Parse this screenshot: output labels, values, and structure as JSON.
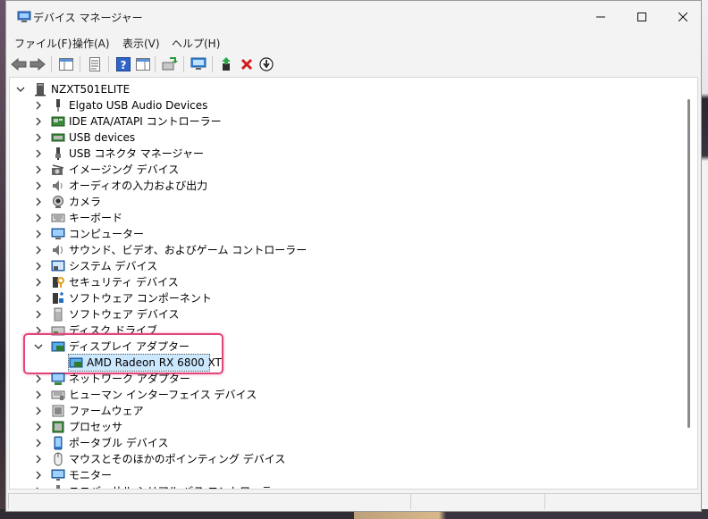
{
  "window": {
    "title": "デバイス マネージャー"
  },
  "menu": [
    "ファイル(F)",
    "操作(A)",
    "表示(V)",
    "ヘルプ(H)"
  ],
  "tree": {
    "root": "NZXT501ELITE",
    "categories": [
      {
        "label": "Elgato USB Audio Devices",
        "icon": "audio-jack-icon"
      },
      {
        "label": "IDE ATA/ATAPI コントローラー",
        "icon": "storage-controller-icon"
      },
      {
        "label": "USB devices",
        "icon": "usb-device-icon"
      },
      {
        "label": "USB コネクタ マネージャー",
        "icon": "usb-connector-icon"
      },
      {
        "label": "イメージング デバイス",
        "icon": "imaging-device-icon"
      },
      {
        "label": "オーディオの入力および出力",
        "icon": "speaker-icon"
      },
      {
        "label": "カメラ",
        "icon": "camera-icon"
      },
      {
        "label": "キーボード",
        "icon": "keyboard-icon"
      },
      {
        "label": "コンピューター",
        "icon": "computer-icon"
      },
      {
        "label": "サウンド、ビデオ、およびゲーム コントローラー",
        "icon": "sound-icon"
      },
      {
        "label": "システム デバイス",
        "icon": "system-device-icon"
      },
      {
        "label": "セキュリティ デバイス",
        "icon": "security-key-icon"
      },
      {
        "label": "ソフトウェア コンポーネント",
        "icon": "software-component-icon"
      },
      {
        "label": "ソフトウェア デバイス",
        "icon": "software-device-icon"
      },
      {
        "label": "ディスク ドライブ",
        "icon": "disk-drive-icon"
      },
      {
        "label": "ディスプレイ アダプター",
        "icon": "display-adapter-icon",
        "expanded": true,
        "children": [
          {
            "label": "AMD Radeon RX 6800 XT",
            "icon": "display-adapter-icon",
            "selected": true
          }
        ]
      },
      {
        "label": "ネットワーク アダプター",
        "icon": "network-adapter-icon"
      },
      {
        "label": "ヒューマン インターフェイス デバイス",
        "icon": "hid-icon"
      },
      {
        "label": "ファームウェア",
        "icon": "firmware-icon"
      },
      {
        "label": "プロセッサ",
        "icon": "processor-icon"
      },
      {
        "label": "ポータブル デバイス",
        "icon": "portable-device-icon"
      },
      {
        "label": "マウスとそのほかのポインティング デバイス",
        "icon": "mouse-icon"
      },
      {
        "label": "モニター",
        "icon": "monitor-icon"
      },
      {
        "label": "ユニバーサル シリアル バス コントローラー",
        "icon": "usb-controller-icon"
      }
    ]
  },
  "colors": {
    "selection": "#cce8ff",
    "highlight": "#e2457a",
    "monitor_blue": "#1f6fc4"
  }
}
